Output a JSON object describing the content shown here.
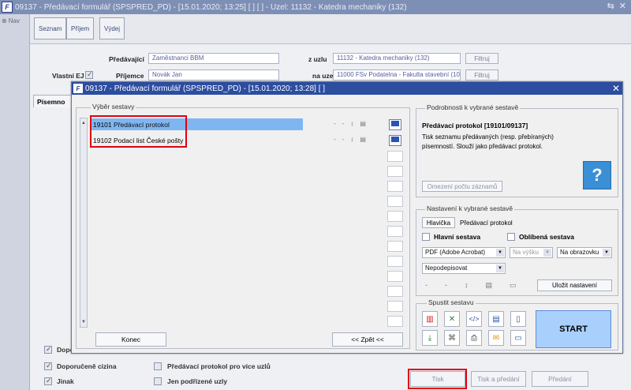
{
  "window": {
    "title": "09137 - Předávací formulář (SPSPRED_PD) - [15.01.2020; 13:25]  [ ]  [ ] - Uzel: 11132 - Katedra mechaniky (132)",
    "controls": [
      "⇆",
      "✕"
    ]
  },
  "nav": {
    "label": "Nav"
  },
  "toolbar": {
    "seznam": "Seznam",
    "prijem": "Příjem",
    "vydej": "Výdej"
  },
  "form": {
    "predavajici_label": "Předávající",
    "predavajici_value": "Zaměstnanci BBM",
    "z_uzlu_label": "z uzlu",
    "z_uzlu_value": "11132 - Katedra mechaniky (132)",
    "filtruj": "Filtruj",
    "vlastni_ej_label": "Vlastní EJ",
    "prijemce_label": "Příjemce",
    "prijemce_value": "Novák Jan",
    "na_uzel_label": "na uzel",
    "na_uzel_value": "11000 FSv Podatelna - Fakulta stavební (100)",
    "tab_label": "Písemno"
  },
  "bottom": {
    "dopor_short": "Dopor",
    "doporucene_cizina": "Doporučeně cizina",
    "jinak": "Jinak",
    "predavaci_vice": "Předávací protokol pro více uzlů",
    "jen_podrizene": "Jen podřízené uzly",
    "tisk": "Tisk",
    "tisk_predani": "Tisk a předání",
    "predani": "Předání"
  },
  "dialog": {
    "title": "09137 - Předávací formulář (SPSPRED_PD) - [15.01.2020; 13:28]  [ ]",
    "close": "✕",
    "vyber_label": "Výběr sestavy",
    "reports": [
      {
        "code": "19101",
        "name": "Předávací protokol"
      },
      {
        "code": "19102",
        "name": "Podací list České pošty"
      }
    ],
    "row_icons": [
      "-",
      "-",
      "↕",
      "▤"
    ],
    "konec": "Konec",
    "zpet": "<< Zpět <<",
    "podrobnosti_label": "Podrobnosti k vybrané sestavě",
    "detail_title": "Předávací protokol [19101/09137]",
    "detail_text": "Tisk seznamu předávaných (resp. přebíraných) písemností. Slouží jako předávací protokol.",
    "omezeni": "Omezení počtu záznamů",
    "nastaveni_label": "Nastavení k vybrané sestavě",
    "hlavicka": "Hlavička",
    "hlavicka_value": "Předávací protokol",
    "hlavni_sestava": "Hlavní sestava",
    "oblibena_sestava": "Oblíbená sestava",
    "format": "PDF (Adobe Acrobat)",
    "orientace": "Na výšku",
    "vystup": "Na obrazovku",
    "podpis": "Nepodepisovat",
    "settings_icons": [
      "-",
      "-",
      "↕",
      "▤",
      "▭"
    ],
    "ulozit": "Uložit nastavení",
    "spustit_label": "Spustit sestavu",
    "start": "START",
    "run_icons": [
      "pdf-icon",
      "excel-icon",
      "xml-icon",
      "word-icon",
      "doc-icon",
      "download-icon",
      "attach-icon",
      "print-icon",
      "email-icon",
      "screen-icon"
    ],
    "colors": {
      "title_bar": "#2c4da0",
      "selection": "#7fb6f2",
      "highlight_box": "#e00010",
      "start": "#a9cffc"
    }
  }
}
